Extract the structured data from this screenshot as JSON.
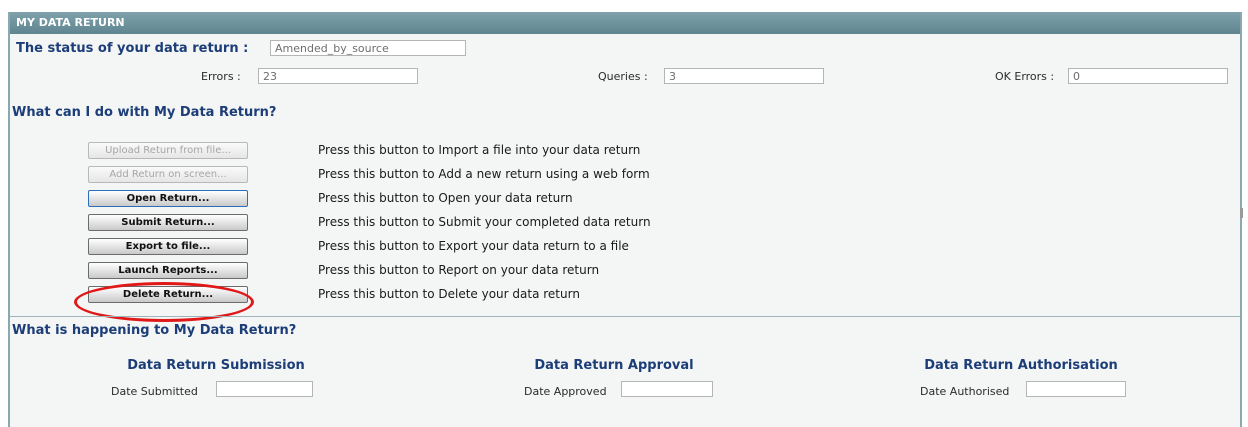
{
  "header": {
    "title": "MY DATA RETURN"
  },
  "status": {
    "label": "The status of your data return :",
    "value": "Amended_by_source",
    "errors_label": "Errors :",
    "errors_value": "23",
    "queries_label": "Queries :",
    "queries_value": "3",
    "ok_errors_label": "OK Errors :",
    "ok_errors_value": "0"
  },
  "actions": {
    "title": "What can I do with My Data Return?",
    "items": [
      {
        "button": "Upload Return from file...",
        "description": "Press this button to Import a file into your data return",
        "enabled": false
      },
      {
        "button": "Add Return on screen...",
        "description": "Press this button to Add a new return using a web form",
        "enabled": false
      },
      {
        "button": "Open Return...",
        "description": "Press this button to Open your data return",
        "enabled": true
      },
      {
        "button": "Submit Return...",
        "description": "Press this button to Submit your completed data return",
        "enabled": true
      },
      {
        "button": "Export to file...",
        "description": "Press this button to Export your data return to a file",
        "enabled": true
      },
      {
        "button": "Launch Reports...",
        "description": "Press this button to Report on your data return",
        "enabled": true
      },
      {
        "button": "Delete Return...",
        "description": "Press this button to Delete your data return",
        "enabled": true
      }
    ]
  },
  "happening": {
    "title": "What is happening to My Data Return?",
    "submission": {
      "title": "Data Return Submission",
      "label": "Date Submitted",
      "value": ""
    },
    "approval": {
      "title": "Data Return Approval",
      "label": "Date Approved",
      "value": ""
    },
    "authorisation": {
      "title": "Data Return Authorisation",
      "label": "Date Authorised",
      "value": ""
    }
  },
  "colors": {
    "header": "#6a8e98",
    "heading_text": "#1c3d78",
    "highlight": "#e01818"
  }
}
